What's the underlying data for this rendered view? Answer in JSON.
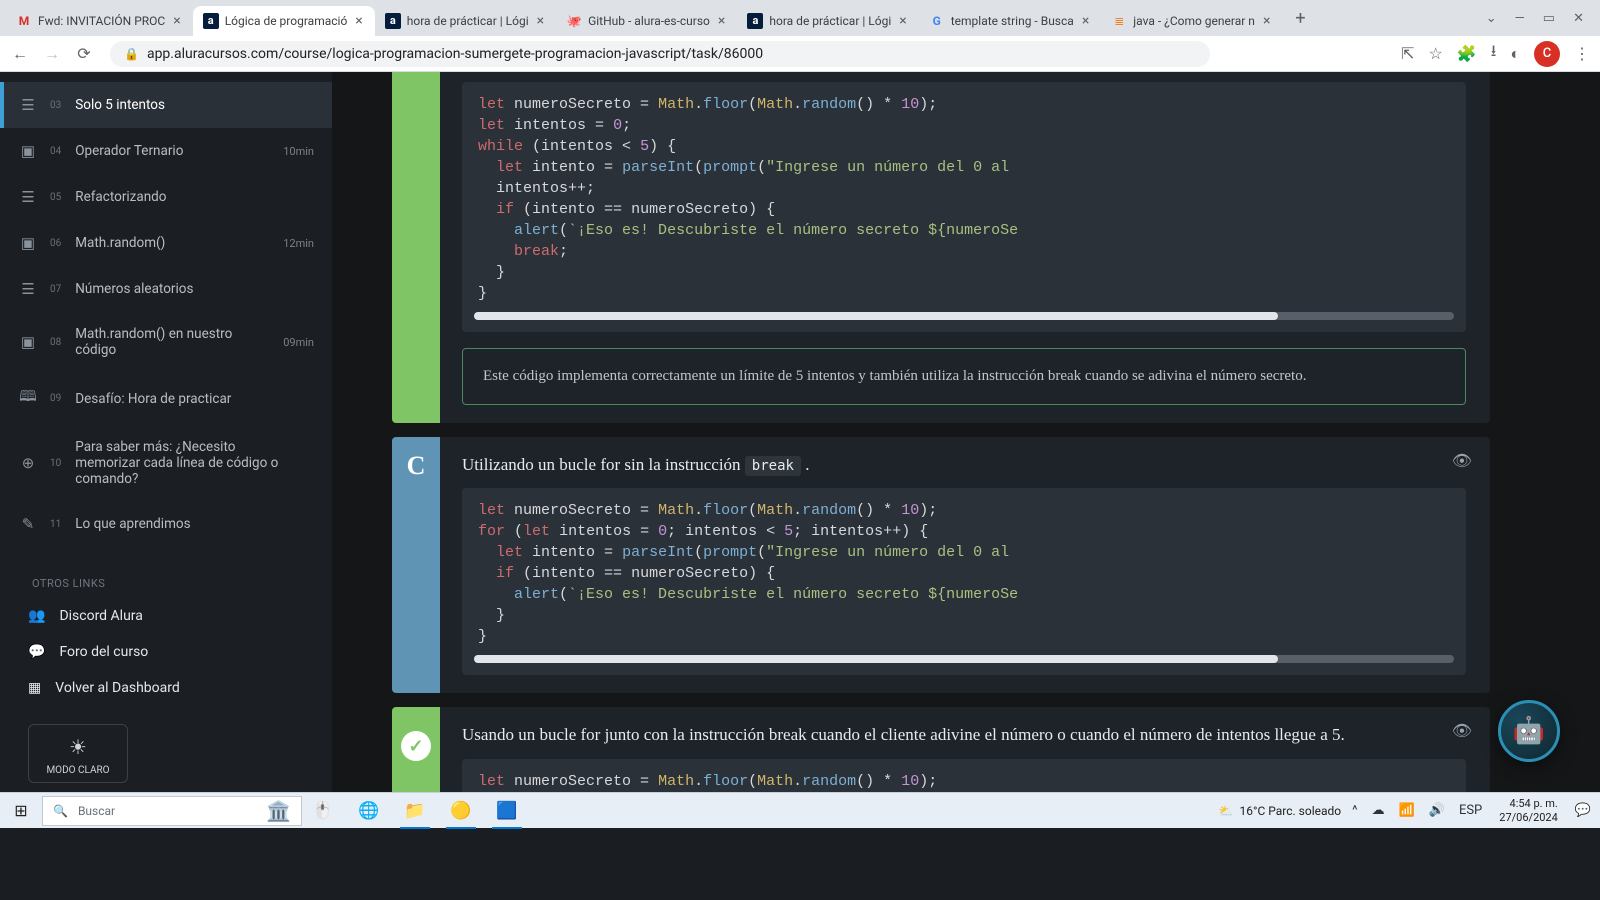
{
  "browser": {
    "tabs": [
      {
        "favicon": "M",
        "title": "Fwd: INVITACIÓN PROC"
      },
      {
        "favicon": "a",
        "title": "Lógica de programació"
      },
      {
        "favicon": "a",
        "title": "hora de prácticar | Lógi"
      },
      {
        "favicon": "GH",
        "title": "GitHub - alura-es-curso"
      },
      {
        "favicon": "a",
        "title": "hora de prácticar | Lógi"
      },
      {
        "favicon": "G",
        "title": "template string - Busca"
      },
      {
        "favicon": "so",
        "title": "java - ¿Como generar n"
      }
    ],
    "active_tab_index": 1,
    "url": "app.aluracursos.com/course/logica-programacion-sumergete-programacion-javascript/task/86000",
    "avatar_letter": "C"
  },
  "sidebar": {
    "lessons": [
      {
        "num": "03",
        "label": "Solo 5 intentos",
        "dur": "",
        "icon": "☰",
        "active": true
      },
      {
        "num": "04",
        "label": "Operador Ternario",
        "dur": "10min",
        "icon": "▣",
        "active": false
      },
      {
        "num": "05",
        "label": "Refactorizando",
        "dur": "",
        "icon": "☰",
        "active": false
      },
      {
        "num": "06",
        "label": "Math.random()",
        "dur": "12min",
        "icon": "▣",
        "active": false
      },
      {
        "num": "07",
        "label": "Números aleatorios",
        "dur": "",
        "icon": "☰",
        "active": false
      },
      {
        "num": "08",
        "label": "Math.random() en nuestro código",
        "dur": "09min",
        "icon": "▣",
        "active": false
      },
      {
        "num": "09",
        "label": "Desafío: Hora de practicar",
        "dur": "",
        "icon": "🕮",
        "active": false
      },
      {
        "num": "10",
        "label": "Para saber más: ¿Necesito memorizar cada línea de código o comando?",
        "dur": "",
        "icon": "⊕",
        "active": false
      },
      {
        "num": "11",
        "label": "Lo que aprendimos",
        "dur": "",
        "icon": "✎",
        "active": false
      }
    ],
    "other_title": "OTROS LINKS",
    "other_links": [
      {
        "icon": "👥",
        "label": "Discord Alura"
      },
      {
        "icon": "💬",
        "label": "Foro del curso"
      },
      {
        "icon": "▦",
        "label": "Volver al Dashboard"
      }
    ],
    "modo": "MODO CLARO"
  },
  "answers": {
    "b": {
      "feedback": "Este código implementa correctamente un límite de 5 intentos y también utiliza la instrucción break cuando se adivina el número secreto."
    },
    "c": {
      "letter": "C",
      "title_pre": "Utilizando un bucle for sin la instrucción ",
      "title_code": "break",
      "title_post": " ."
    },
    "d": {
      "title": "Usando un bucle for junto con la instrucción break cuando el cliente adivine el número o cuando el número de intentos llegue a 5."
    }
  },
  "code_strings": {
    "line1_secret": "let numeroSecreto = Math.floor(Math.random() * 10);",
    "b_intentos": "let intentos = 0;",
    "b_while": "while (intentos < 5) {",
    "for_header": "for (let intentos = 0; intentos < 5; intentos++) {",
    "intento_prompt": "  let intento = parseInt(prompt(\"Ingrese un número del 0 al",
    "intentospp": "  intentos++;",
    "if_line": "  if (intento == numeroSecreto) {",
    "alert_line": "    alert(`¡Eso es! Descubriste el número secreto ${numeroSe",
    "break_line": "    break;",
    "close1": "  }",
    "close2": "}"
  },
  "taskbar": {
    "search_placeholder": "Buscar",
    "weather": "16°C  Parc. soleado",
    "lang": "ESP",
    "time": "4:54 p. m.",
    "date": "27/06/2024"
  }
}
